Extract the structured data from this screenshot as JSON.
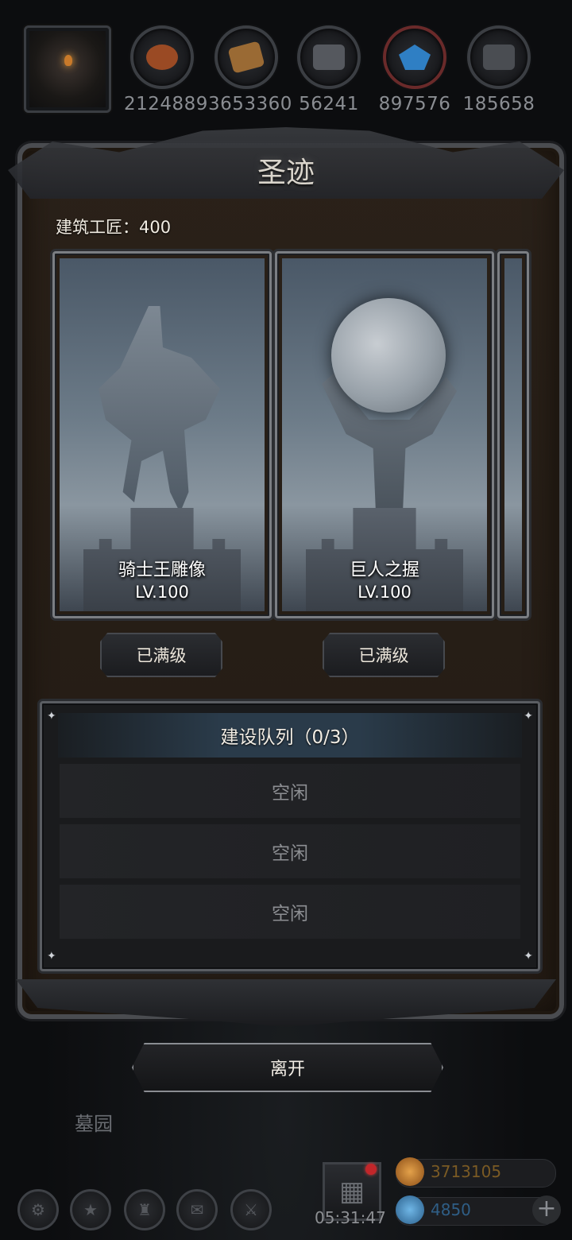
{
  "resources": [
    {
      "icon": "meat-icon",
      "value": "2124889",
      "color": "#b0552a"
    },
    {
      "icon": "wood-icon",
      "value": "3653360",
      "color": "#a8743a"
    },
    {
      "icon": "iron-icon",
      "value": "56241",
      "color": "#6f7379"
    },
    {
      "icon": "crystal-icon",
      "value": "897576",
      "color": "#2f7fc4"
    },
    {
      "icon": "stone-icon",
      "value": "185658",
      "color": "#5a5d62"
    }
  ],
  "panel": {
    "title": "圣迹",
    "workers_label": "建筑工匠：400"
  },
  "relics": [
    {
      "name": "骑士王雕像",
      "level": "LV.100",
      "status": "已满级"
    },
    {
      "name": "巨人之握",
      "level": "LV.100",
      "status": "已满级"
    }
  ],
  "queue": {
    "title": "建设队列（0/3）",
    "slots": [
      "空闲",
      "空闲",
      "空闲"
    ]
  },
  "leave_label": "离开",
  "map": {
    "location_label": "墓园"
  },
  "hud": {
    "timer": "05:31:47",
    "gold": "3713105",
    "gems": "4850",
    "plus": "+"
  }
}
